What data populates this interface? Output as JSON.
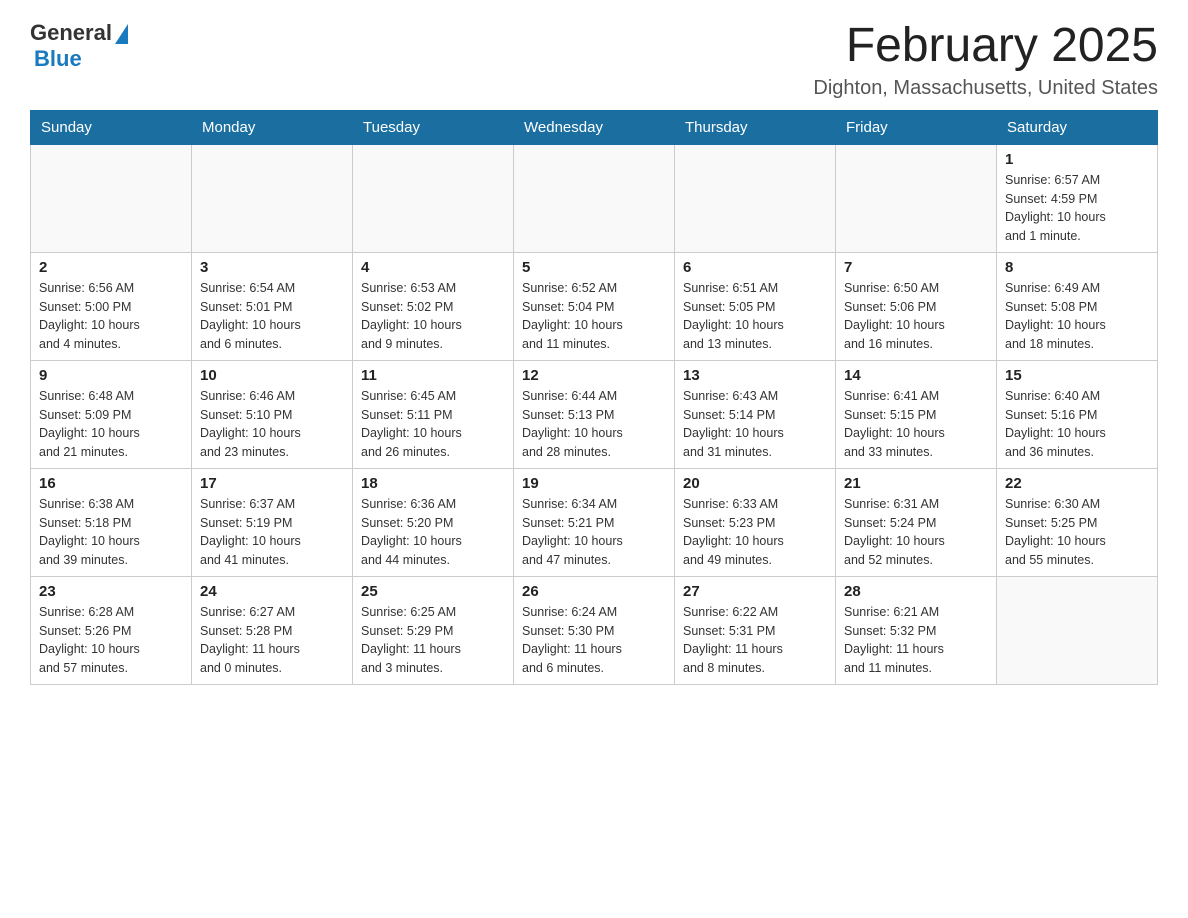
{
  "logo": {
    "general": "General",
    "blue": "Blue"
  },
  "title": "February 2025",
  "location": "Dighton, Massachusetts, United States",
  "weekdays": [
    "Sunday",
    "Monday",
    "Tuesday",
    "Wednesday",
    "Thursday",
    "Friday",
    "Saturday"
  ],
  "weeks": [
    [
      {
        "day": "",
        "info": ""
      },
      {
        "day": "",
        "info": ""
      },
      {
        "day": "",
        "info": ""
      },
      {
        "day": "",
        "info": ""
      },
      {
        "day": "",
        "info": ""
      },
      {
        "day": "",
        "info": ""
      },
      {
        "day": "1",
        "info": "Sunrise: 6:57 AM\nSunset: 4:59 PM\nDaylight: 10 hours\nand 1 minute."
      }
    ],
    [
      {
        "day": "2",
        "info": "Sunrise: 6:56 AM\nSunset: 5:00 PM\nDaylight: 10 hours\nand 4 minutes."
      },
      {
        "day": "3",
        "info": "Sunrise: 6:54 AM\nSunset: 5:01 PM\nDaylight: 10 hours\nand 6 minutes."
      },
      {
        "day": "4",
        "info": "Sunrise: 6:53 AM\nSunset: 5:02 PM\nDaylight: 10 hours\nand 9 minutes."
      },
      {
        "day": "5",
        "info": "Sunrise: 6:52 AM\nSunset: 5:04 PM\nDaylight: 10 hours\nand 11 minutes."
      },
      {
        "day": "6",
        "info": "Sunrise: 6:51 AM\nSunset: 5:05 PM\nDaylight: 10 hours\nand 13 minutes."
      },
      {
        "day": "7",
        "info": "Sunrise: 6:50 AM\nSunset: 5:06 PM\nDaylight: 10 hours\nand 16 minutes."
      },
      {
        "day": "8",
        "info": "Sunrise: 6:49 AM\nSunset: 5:08 PM\nDaylight: 10 hours\nand 18 minutes."
      }
    ],
    [
      {
        "day": "9",
        "info": "Sunrise: 6:48 AM\nSunset: 5:09 PM\nDaylight: 10 hours\nand 21 minutes."
      },
      {
        "day": "10",
        "info": "Sunrise: 6:46 AM\nSunset: 5:10 PM\nDaylight: 10 hours\nand 23 minutes."
      },
      {
        "day": "11",
        "info": "Sunrise: 6:45 AM\nSunset: 5:11 PM\nDaylight: 10 hours\nand 26 minutes."
      },
      {
        "day": "12",
        "info": "Sunrise: 6:44 AM\nSunset: 5:13 PM\nDaylight: 10 hours\nand 28 minutes."
      },
      {
        "day": "13",
        "info": "Sunrise: 6:43 AM\nSunset: 5:14 PM\nDaylight: 10 hours\nand 31 minutes."
      },
      {
        "day": "14",
        "info": "Sunrise: 6:41 AM\nSunset: 5:15 PM\nDaylight: 10 hours\nand 33 minutes."
      },
      {
        "day": "15",
        "info": "Sunrise: 6:40 AM\nSunset: 5:16 PM\nDaylight: 10 hours\nand 36 minutes."
      }
    ],
    [
      {
        "day": "16",
        "info": "Sunrise: 6:38 AM\nSunset: 5:18 PM\nDaylight: 10 hours\nand 39 minutes."
      },
      {
        "day": "17",
        "info": "Sunrise: 6:37 AM\nSunset: 5:19 PM\nDaylight: 10 hours\nand 41 minutes."
      },
      {
        "day": "18",
        "info": "Sunrise: 6:36 AM\nSunset: 5:20 PM\nDaylight: 10 hours\nand 44 minutes."
      },
      {
        "day": "19",
        "info": "Sunrise: 6:34 AM\nSunset: 5:21 PM\nDaylight: 10 hours\nand 47 minutes."
      },
      {
        "day": "20",
        "info": "Sunrise: 6:33 AM\nSunset: 5:23 PM\nDaylight: 10 hours\nand 49 minutes."
      },
      {
        "day": "21",
        "info": "Sunrise: 6:31 AM\nSunset: 5:24 PM\nDaylight: 10 hours\nand 52 minutes."
      },
      {
        "day": "22",
        "info": "Sunrise: 6:30 AM\nSunset: 5:25 PM\nDaylight: 10 hours\nand 55 minutes."
      }
    ],
    [
      {
        "day": "23",
        "info": "Sunrise: 6:28 AM\nSunset: 5:26 PM\nDaylight: 10 hours\nand 57 minutes."
      },
      {
        "day": "24",
        "info": "Sunrise: 6:27 AM\nSunset: 5:28 PM\nDaylight: 11 hours\nand 0 minutes."
      },
      {
        "day": "25",
        "info": "Sunrise: 6:25 AM\nSunset: 5:29 PM\nDaylight: 11 hours\nand 3 minutes."
      },
      {
        "day": "26",
        "info": "Sunrise: 6:24 AM\nSunset: 5:30 PM\nDaylight: 11 hours\nand 6 minutes."
      },
      {
        "day": "27",
        "info": "Sunrise: 6:22 AM\nSunset: 5:31 PM\nDaylight: 11 hours\nand 8 minutes."
      },
      {
        "day": "28",
        "info": "Sunrise: 6:21 AM\nSunset: 5:32 PM\nDaylight: 11 hours\nand 11 minutes."
      },
      {
        "day": "",
        "info": ""
      }
    ]
  ]
}
